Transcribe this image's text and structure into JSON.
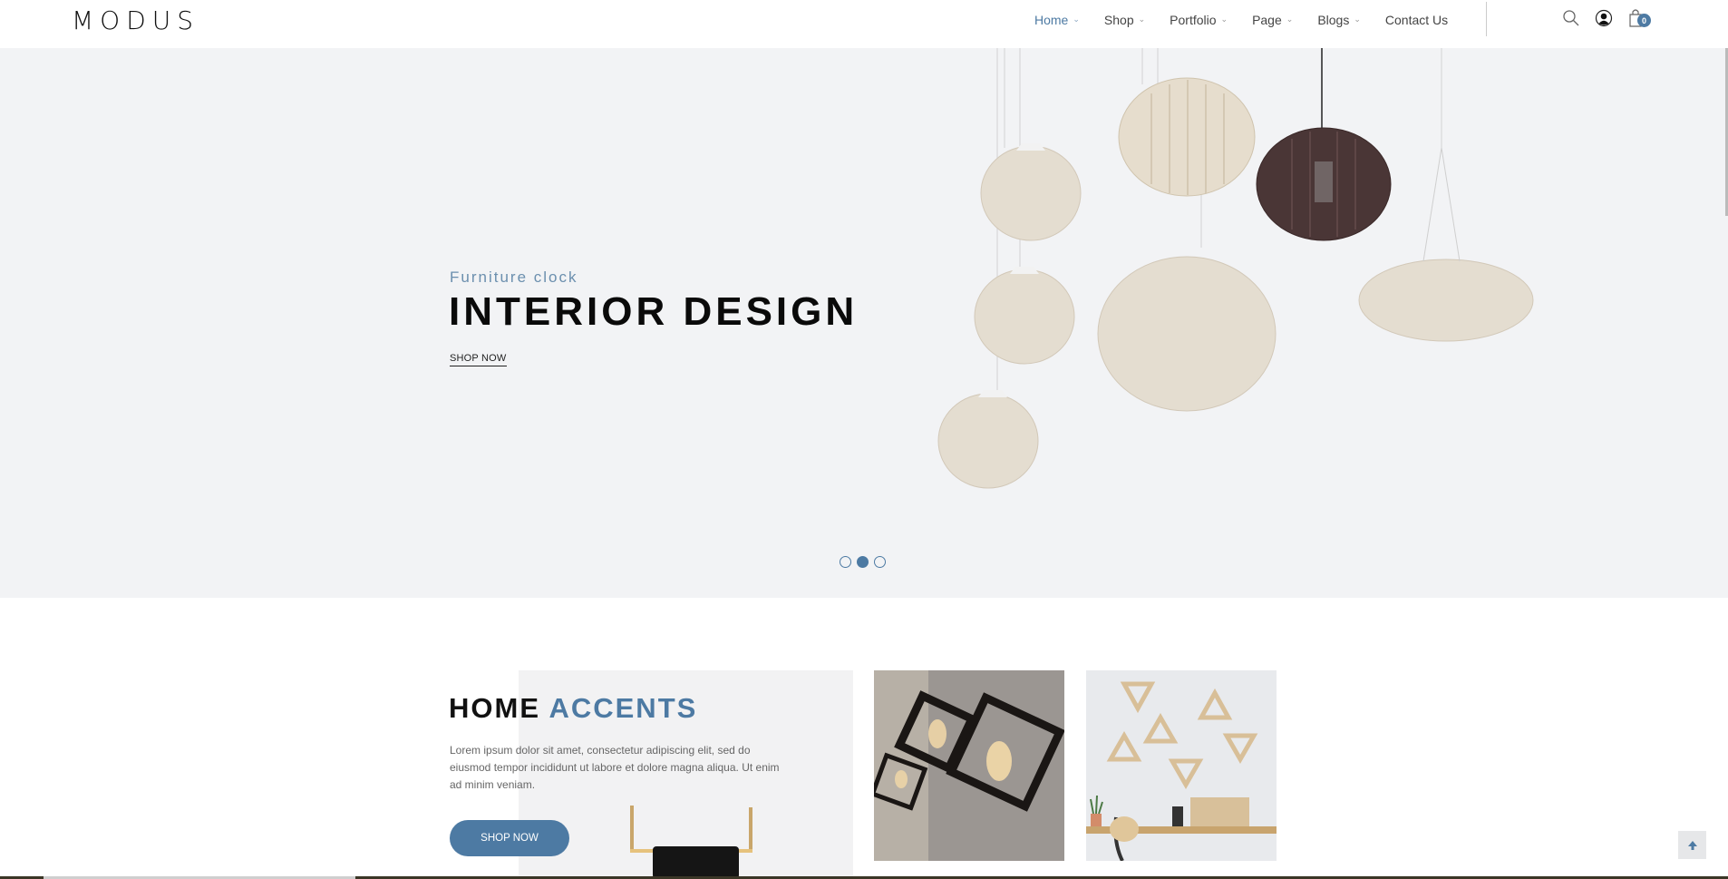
{
  "header": {
    "logo": "MODUS",
    "nav": [
      {
        "label": "Home",
        "dropdown": true,
        "active": true
      },
      {
        "label": "Shop",
        "dropdown": true,
        "active": false
      },
      {
        "label": "Portfolio",
        "dropdown": true,
        "active": false
      },
      {
        "label": "Page",
        "dropdown": true,
        "active": false
      },
      {
        "label": "Blogs",
        "dropdown": true,
        "active": false
      },
      {
        "label": "Contact Us",
        "dropdown": false,
        "active": false
      }
    ],
    "icons": [
      "search-icon",
      "user-icon",
      "cart-icon"
    ],
    "cart_count": "0"
  },
  "hero": {
    "subtitle": "Furniture clock",
    "title": "INTERIOR DESIGN",
    "link": "SHOP NOW",
    "slides": 3,
    "active_slide": 2
  },
  "accents": {
    "title_dark": "HOME",
    "title_blue": "ACCENTS",
    "text": "Lorem ipsum dolor sit amet, consectetur adipiscing elit, sed do eiusmod tempor incididunt ut labore et dolore magna aliqua. Ut enim ad minim veniam.",
    "button": "SHOP NOW",
    "tiles": [
      "pendant-lights-image",
      "wall-shelves-desk-image"
    ]
  },
  "colors": {
    "accent": "#4d7aa3",
    "hero_bg": "#f2f3f5",
    "text_dark": "#0a0a0a"
  }
}
